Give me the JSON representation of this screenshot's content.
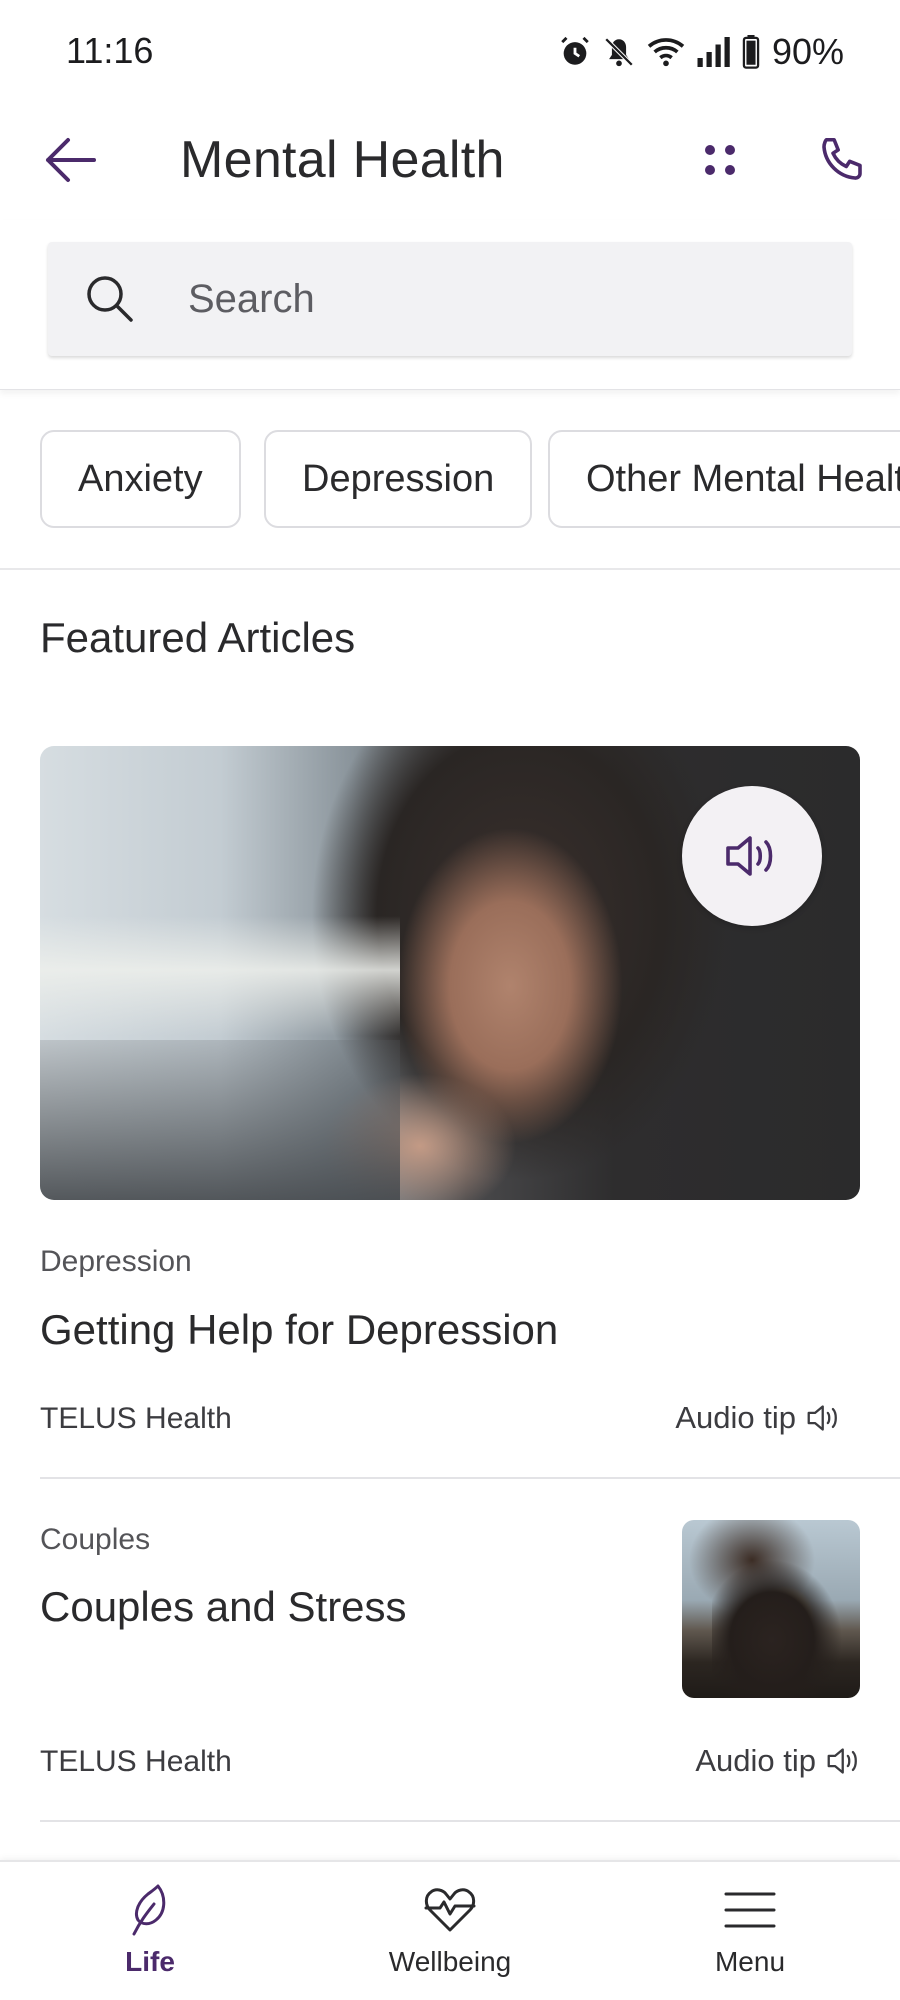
{
  "status_bar": {
    "time": "11:16",
    "battery": "90%"
  },
  "header": {
    "title": "Mental Health"
  },
  "search": {
    "placeholder": "Search"
  },
  "chips": [
    "Anxiety",
    "Depression",
    "Other Mental Health"
  ],
  "section_title": "Featured Articles",
  "articles": [
    {
      "category": "Depression",
      "title": "Getting Help for Depression",
      "source": "TELUS Health",
      "audio_label": "Audio tip"
    },
    {
      "category": "Couples",
      "title": "Couples and Stress",
      "source": "TELUS Health",
      "audio_label": "Audio tip"
    }
  ],
  "bottom_nav": [
    {
      "label": "Life",
      "icon": "leaf-icon",
      "active": true
    },
    {
      "label": "Wellbeing",
      "icon": "heart-pulse-icon",
      "active": false
    },
    {
      "label": "Menu",
      "icon": "hamburger-menu-icon",
      "active": false
    }
  ],
  "colors": {
    "accent": "#4b2a6b",
    "text": "#2a2a2c",
    "divider": "#e3e3e6",
    "search_bg": "#f2f2f4"
  }
}
